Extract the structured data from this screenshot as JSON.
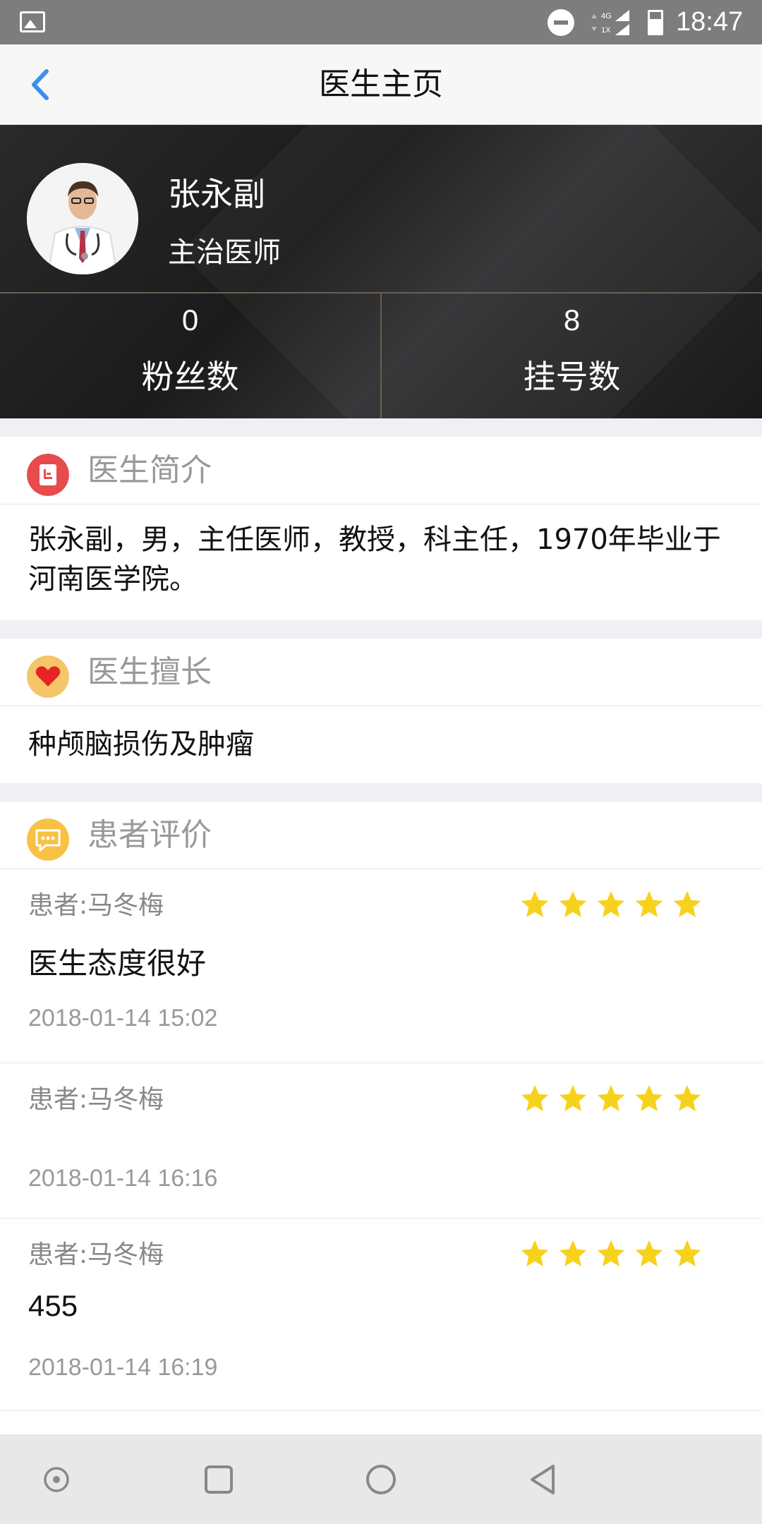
{
  "status_bar": {
    "time": "18:47",
    "icons": [
      "image-icon",
      "do-not-disturb-icon",
      "signal-4g-icon",
      "battery-icon"
    ]
  },
  "header": {
    "title": "医生主页",
    "back_icon": "chevron-left-icon",
    "accent_color": "#3d8ef0"
  },
  "doctor": {
    "name": "张永副",
    "title": "主治医师",
    "stats": [
      {
        "value": "0",
        "label": "粉丝数"
      },
      {
        "value": "8",
        "label": "挂号数"
      }
    ]
  },
  "intro": {
    "heading": "医生简介",
    "icon": "document-icon",
    "icon_color": "#e84b4b",
    "text": "张永副，男，主任医师，教授，科主任，1970年毕业于河南医学院。"
  },
  "specialty": {
    "heading": "医生擅长",
    "icon": "heart-icon",
    "icon_color": "#f5c56a",
    "text": "种颅脑损伤及肿瘤"
  },
  "reviews": {
    "heading": "患者评价",
    "icon": "chat-icon",
    "icon_color": "#f7c244",
    "star_color": "#f7d21c",
    "items": [
      {
        "patient": "患者:马冬梅",
        "rating": 5,
        "content": "医生态度很好",
        "time": "2018-01-14 15:02"
      },
      {
        "patient": "患者:马冬梅",
        "rating": 5,
        "content": "",
        "time": "2018-01-14 16:16"
      },
      {
        "patient": "患者:马冬梅",
        "rating": 5,
        "content": "455",
        "time": "2018-01-14 16:19"
      }
    ]
  },
  "system_nav": [
    "record-icon",
    "recents-square-icon",
    "home-circle-icon",
    "back-triangle-icon"
  ]
}
